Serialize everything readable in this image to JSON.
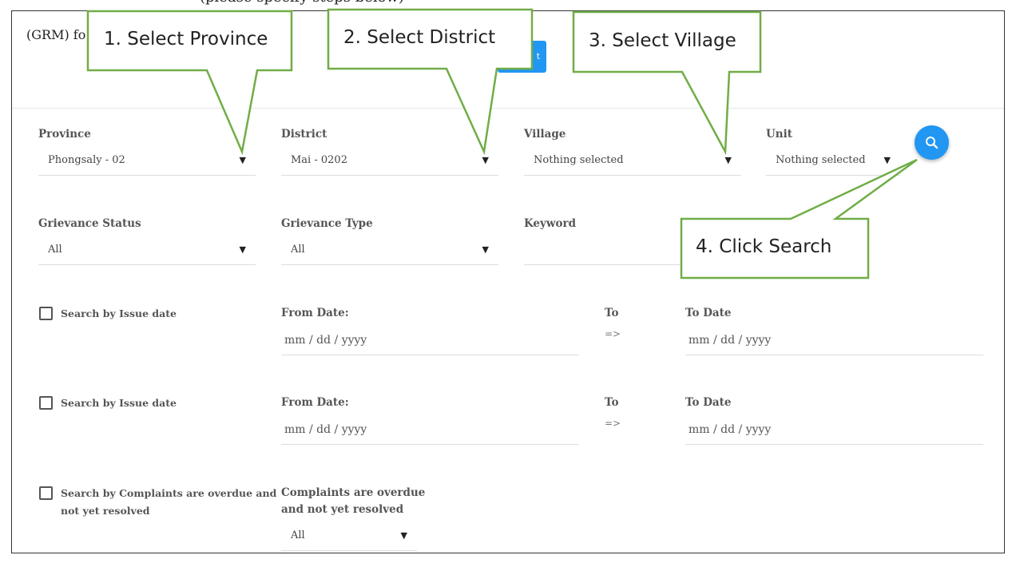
{
  "header": {
    "title_visible": "(GRM) fo",
    "action_button_label": "t"
  },
  "filters": {
    "province": {
      "label": "Province",
      "value": "Phongsaly - 02"
    },
    "district": {
      "label": "District",
      "value": "Mai - 0202"
    },
    "village": {
      "label": "Village",
      "value": "Nothing selected"
    },
    "unit": {
      "label": "Unit",
      "value": "Nothing selected"
    },
    "grievance_status": {
      "label": "Grievance Status",
      "value": "All"
    },
    "grievance_type": {
      "label": "Grievance Type",
      "value": "All"
    },
    "keyword": {
      "label": "Keyword",
      "value": ""
    }
  },
  "search_icon": "search-icon",
  "date_rows": [
    {
      "checkbox_label": "Search by Issue date",
      "from_label": "From Date:",
      "from_placeholder": "mm / dd / yyyy",
      "to": "To",
      "arrow": "=>",
      "to_label": "To Date",
      "to_placeholder": "mm / dd / yyyy"
    },
    {
      "checkbox_label": "Search by Issue date",
      "from_label": "From Date:",
      "from_placeholder": "mm / dd / yyyy",
      "to": "To",
      "arrow": "=>",
      "to_label": "To Date",
      "to_placeholder": "mm / dd / yyyy"
    }
  ],
  "overdue": {
    "checkbox_line1": "Search by Complaints are overdue and",
    "checkbox_line2": "not yet resolved",
    "label_line1": "Complaints are overdue",
    "label_line2": "and not yet resolved",
    "value": "All"
  },
  "callouts": {
    "step1": "1. Select Province",
    "step2": "2. Select District",
    "step3": "3. Select Village",
    "step4": "4. Click Search"
  },
  "colors": {
    "accent": "#2196f3",
    "callout_border": "#70ad47"
  }
}
